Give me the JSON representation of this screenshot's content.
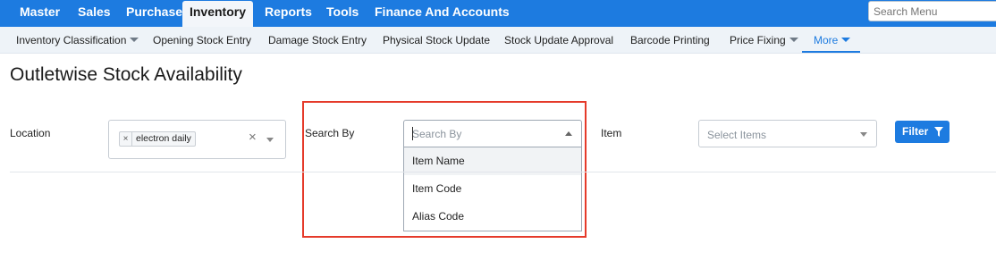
{
  "topnav": {
    "items": [
      {
        "label": "Master"
      },
      {
        "label": "Sales"
      },
      {
        "label": "Purchase"
      },
      {
        "label": "Inventory"
      },
      {
        "label": "Reports"
      },
      {
        "label": "Tools"
      },
      {
        "label": "Finance And Accounts"
      }
    ],
    "search_placeholder": "Search Menu"
  },
  "subnav": {
    "items": [
      {
        "label": "Inventory Classification"
      },
      {
        "label": "Opening Stock Entry"
      },
      {
        "label": "Damage Stock Entry"
      },
      {
        "label": "Physical Stock Update"
      },
      {
        "label": "Stock Update Approval"
      },
      {
        "label": "Barcode Printing"
      },
      {
        "label": "Price Fixing"
      },
      {
        "label": "More"
      }
    ]
  },
  "page": {
    "title": "Outletwise Stock Availability"
  },
  "filters": {
    "location": {
      "label": "Location",
      "selected_chip": "electron daily",
      "chip_remove": "×",
      "clear": "×"
    },
    "search_by": {
      "label": "Search By",
      "placeholder": "Search By",
      "options": [
        {
          "label": "Item Name"
        },
        {
          "label": "Item Code"
        },
        {
          "label": "Alias Code"
        }
      ]
    },
    "item": {
      "label": "Item",
      "placeholder": "Select Items"
    },
    "filter_button": "Filter"
  },
  "colors": {
    "brand_blue": "#1d7be0",
    "highlight_red": "#e53a2a"
  },
  "icons": {
    "filter": "funnel-icon",
    "dropdown": "caret-down-icon"
  }
}
